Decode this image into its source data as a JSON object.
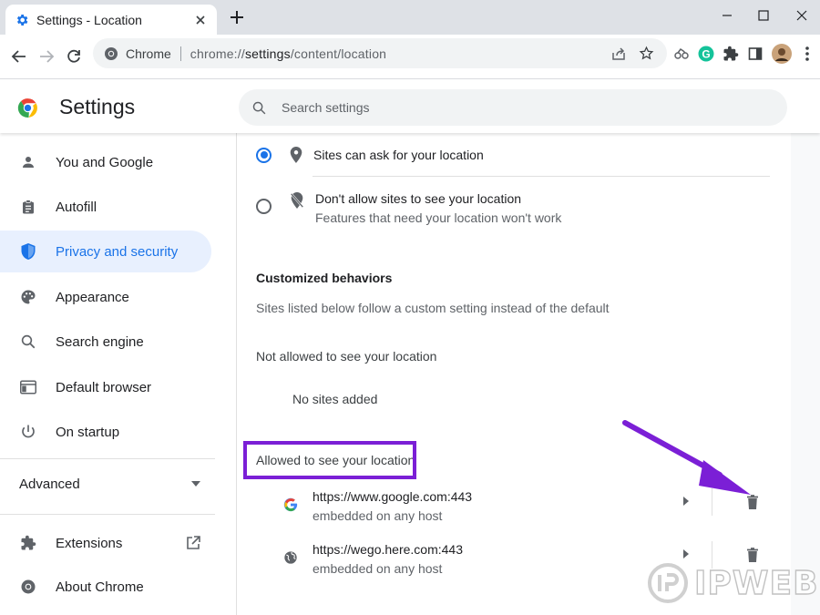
{
  "tab": {
    "title": "Settings - Location",
    "favicon": "gear-icon"
  },
  "toolbar": {
    "chip_label": "Chrome",
    "url_prefix": "chrome://",
    "url_host": "settings",
    "url_path": "/content/location"
  },
  "header": {
    "title": "Settings",
    "search_placeholder": "Search settings"
  },
  "sidebar": {
    "items": [
      {
        "label": "You and Google",
        "icon": "person-icon"
      },
      {
        "label": "Autofill",
        "icon": "clipboard-icon"
      },
      {
        "label": "Privacy and security",
        "icon": "shield-icon",
        "active": true
      },
      {
        "label": "Appearance",
        "icon": "palette-icon"
      },
      {
        "label": "Search engine",
        "icon": "search-icon"
      },
      {
        "label": "Default browser",
        "icon": "browser-window-icon"
      },
      {
        "label": "On startup",
        "icon": "power-icon"
      }
    ],
    "advanced_label": "Advanced",
    "extensions_label": "Extensions",
    "about_label": "About Chrome"
  },
  "main": {
    "option_ask_label": "Sites can ask for your location",
    "option_block_label": "Don't allow sites to see your location",
    "option_block_desc": "Features that need your location won't work",
    "customized_heading": "Customized behaviors",
    "customized_desc": "Sites listed below follow a custom setting instead of the default",
    "not_allowed_heading": "Not allowed to see your location",
    "no_sites": "No sites added",
    "allowed_heading": "Allowed to see your location",
    "allowed_sites": [
      {
        "url": "https://www.google.com:443",
        "sub": "embedded on any host",
        "icon": "google-g-icon"
      },
      {
        "url": "https://wego.here.com:443",
        "sub": "embedded on any host",
        "icon": "globe-icon"
      }
    ]
  },
  "watermark": {
    "text": "IPWEB"
  },
  "colors": {
    "accent": "#1a73e8",
    "annotation": "#7b1fd6",
    "active_bg": "#e8f0fe"
  }
}
